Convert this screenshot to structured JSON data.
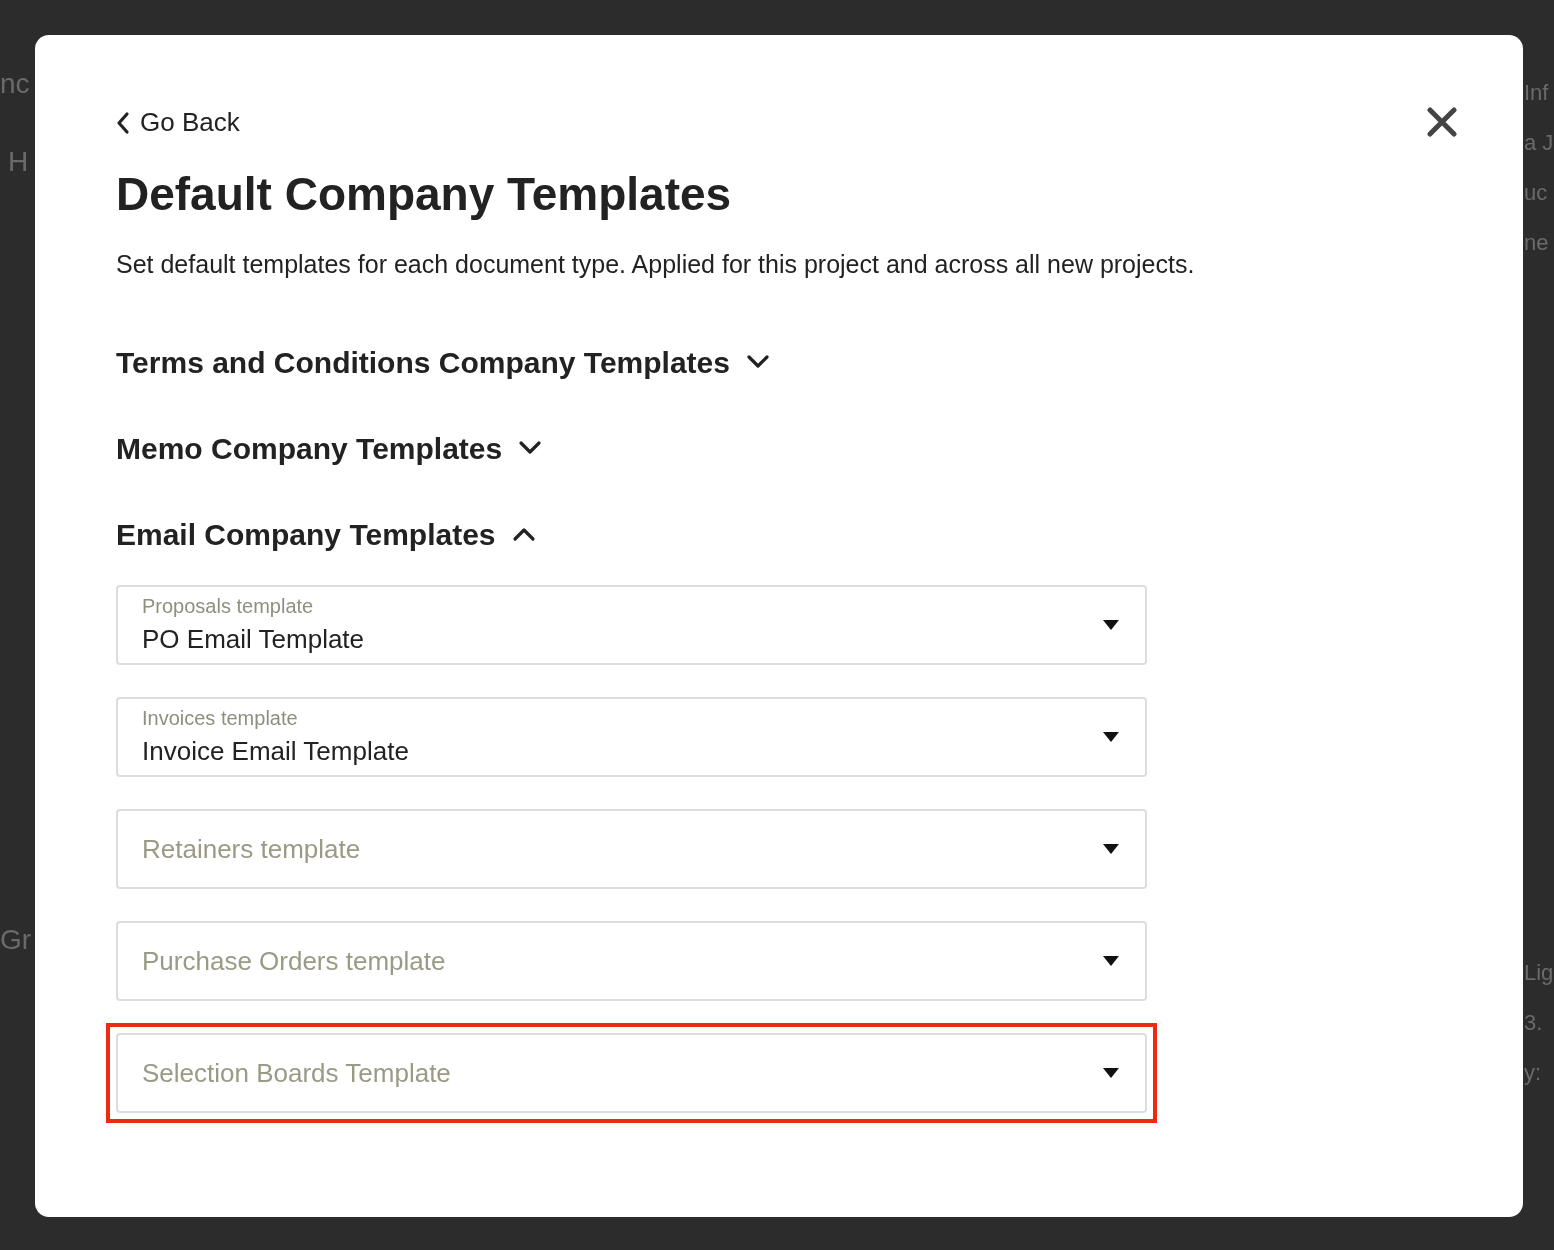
{
  "background_page": {
    "left_texts": [
      "nc",
      "H",
      "Gr"
    ],
    "right_texts": [
      "Inf",
      "a J",
      "uc",
      "ne",
      "Lig",
      "3.",
      "y:"
    ]
  },
  "dialog": {
    "back_label": "Go Back",
    "title": "Default Company Templates",
    "description": "Set default templates for each document type. Applied for this project and across all new projects.",
    "sections": [
      {
        "title": "Terms and Conditions Company Templates",
        "expanded": false
      },
      {
        "title": "Memo Company Templates",
        "expanded": false
      },
      {
        "title": "Email Company Templates",
        "expanded": true,
        "fields": [
          {
            "label": "Proposals template",
            "value": "PO Email Template",
            "highlighted": false
          },
          {
            "label": "Invoices template",
            "value": "Invoice Email Template",
            "highlighted": false
          },
          {
            "placeholder": "Retainers template",
            "highlighted": false
          },
          {
            "placeholder": "Purchase Orders template",
            "highlighted": false
          },
          {
            "placeholder": "Selection Boards Template",
            "highlighted": true
          }
        ]
      }
    ]
  }
}
